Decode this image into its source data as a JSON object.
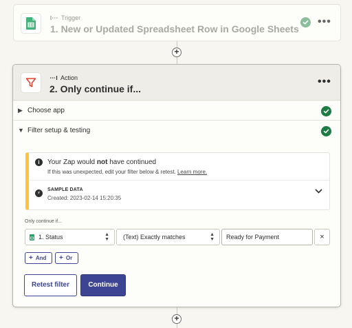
{
  "trigger": {
    "type_label": "Trigger",
    "title": "1. New or Updated Spreadsheet Row in Google Sheets",
    "app_icon": "google-sheets-icon",
    "status": "complete"
  },
  "connector_add_label": "+",
  "action": {
    "type_label": "Action",
    "title": "2. Only continue if...",
    "app_icon": "filter-icon",
    "sections": [
      {
        "label": "Choose app",
        "status": "complete"
      },
      {
        "label": "Filter setup & testing",
        "status": "complete"
      }
    ],
    "notice": {
      "title_prefix": "Your Zap would ",
      "title_bold": "not",
      "title_suffix": " have continued",
      "subtitle": "If this was unexpected, edit your filter below & retest. ",
      "link": "Learn more.",
      "sample_label": "SAMPLE DATA",
      "sample_created": "Created: 2023-02-14 15:20:35"
    },
    "condition": {
      "label": "Only continue if...",
      "field": "1. Status",
      "operator": "(Text) Exactly matches",
      "value": "Ready for Payment",
      "remove_label": "×"
    },
    "and_label": "And",
    "or_label": "Or",
    "retest_label": "Retest filter",
    "continue_label": "Continue"
  },
  "colors": {
    "accent": "#3d4592",
    "success": "#1d7b44",
    "warning": "#ffc43d",
    "filter_icon": "#e0442c",
    "sheets_green": "#23a566"
  }
}
